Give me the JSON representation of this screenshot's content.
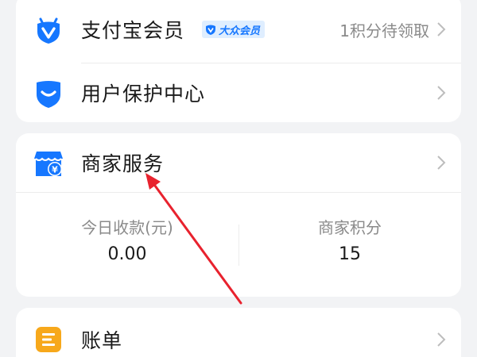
{
  "membership": {
    "title": "支付宝会员",
    "badge_label": "大众会员",
    "points_notice": "1积分待领取",
    "icon": "alipay-member-icon"
  },
  "user_protection": {
    "title": "用户保护中心",
    "icon": "shield-icon"
  },
  "merchant_service": {
    "title": "商家服务",
    "icon": "store-icon",
    "stats": {
      "today_receipts": {
        "label": "今日收款(元)",
        "value": "0.00"
      },
      "merchant_points": {
        "label": "商家积分",
        "value": "15"
      }
    }
  },
  "bills": {
    "title": "账单",
    "icon": "bill-icon"
  },
  "colors": {
    "accent_blue": "#1677ff",
    "bill_orange": "#f7a81b",
    "annotation_red": "#e8222e"
  }
}
